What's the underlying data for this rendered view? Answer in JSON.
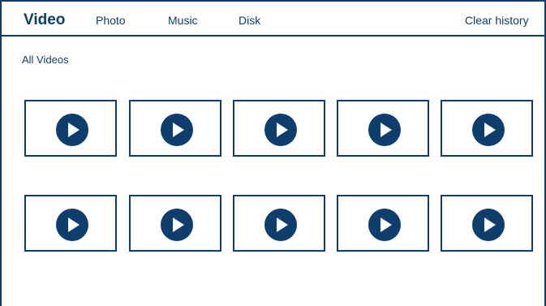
{
  "nav": {
    "tabs": [
      {
        "label": "Video",
        "active": true
      },
      {
        "label": "Photo",
        "active": false
      },
      {
        "label": "Music",
        "active": false
      },
      {
        "label": "Disk",
        "active": false
      }
    ],
    "clear_history_label": "Clear history"
  },
  "main": {
    "section_title": "All Videos",
    "video_tiles": [
      {
        "icon": "play-icon"
      },
      {
        "icon": "play-icon"
      },
      {
        "icon": "play-icon"
      },
      {
        "icon": "play-icon"
      },
      {
        "icon": "play-icon"
      },
      {
        "icon": "play-icon"
      },
      {
        "icon": "play-icon"
      },
      {
        "icon": "play-icon"
      },
      {
        "icon": "play-icon"
      },
      {
        "icon": "play-icon"
      }
    ]
  },
  "colors": {
    "accent": "#0e3e6e",
    "background": "#ffffff"
  }
}
